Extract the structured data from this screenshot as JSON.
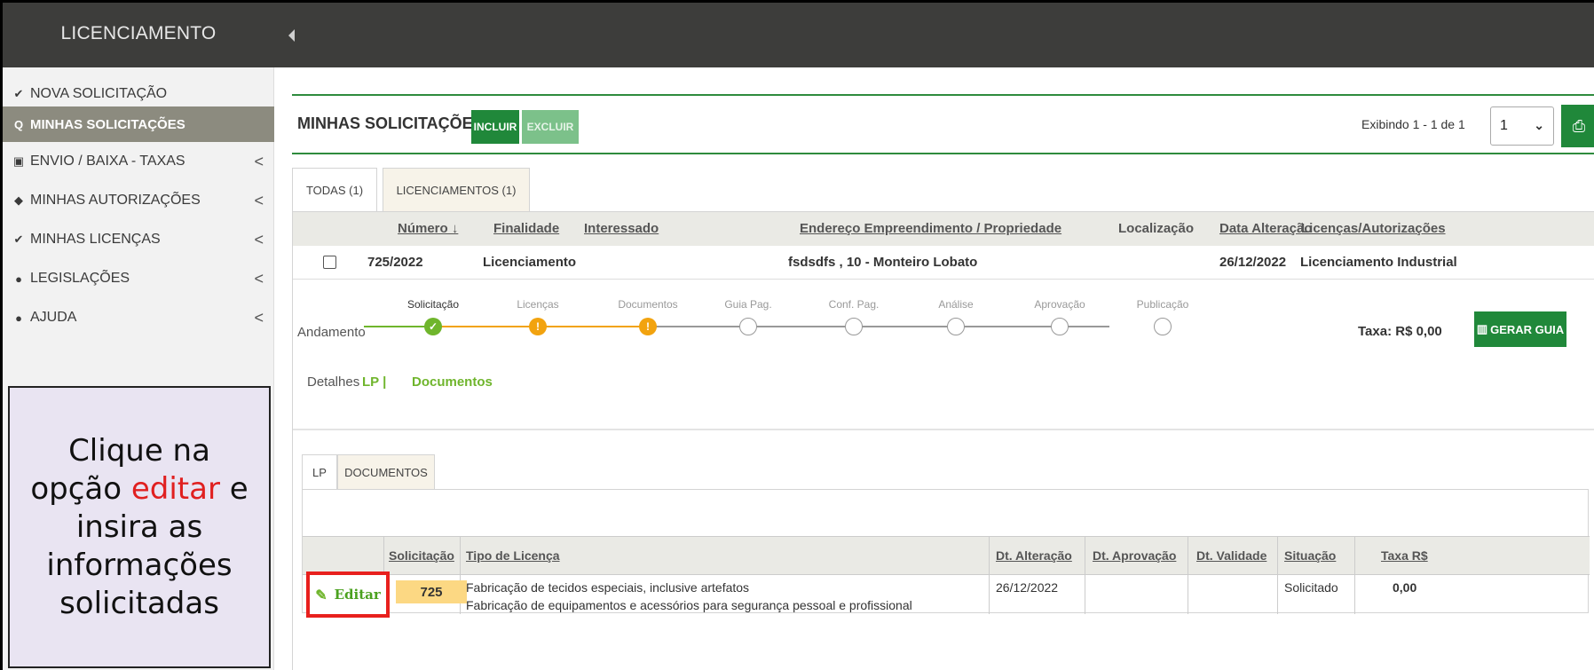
{
  "app": {
    "title": "LICENCIAMENTO"
  },
  "sidebar": {
    "items": [
      {
        "icon": "check-icon",
        "glyph": "✔",
        "label": "NOVA SOLICITAÇÃO"
      },
      {
        "icon": "search-icon",
        "glyph": "Q",
        "label": "MINHAS SOLICITAÇÕES"
      },
      {
        "icon": "money-icon",
        "glyph": "▣",
        "label": "ENVIO / BAIXA - TAXAS"
      },
      {
        "icon": "tag-icon",
        "glyph": "◆",
        "label": "MINHAS AUTORIZAÇÕES"
      },
      {
        "icon": "check-icon",
        "glyph": "✔",
        "label": "MINHAS LICENÇAS"
      },
      {
        "icon": "info-icon",
        "glyph": "●",
        "label": "LEGISLAÇÕES"
      },
      {
        "icon": "info-icon",
        "glyph": "●",
        "label": "AJUDA"
      }
    ],
    "chevron": "<"
  },
  "note": {
    "before": "Clique na opção ",
    "highlight": "editar",
    "after": " e insira as informações solicitadas"
  },
  "header": {
    "title": "MINHAS SOLICITAÇÕES",
    "incluir": "INCLUIR",
    "excluir": "EXCLUIR",
    "exibindo": "Exibindo 1 - 1 de 1",
    "page": "1"
  },
  "tabs": [
    {
      "label": "TODAS (1)"
    },
    {
      "label": "LICENCIAMENTOS (1)"
    }
  ],
  "table": {
    "headers": {
      "numero": "Número ↓",
      "finalidade": "Finalidade",
      "interessado": "Interessado",
      "endereco": "Endereço Empreendimento / Propriedade",
      "localizacao": "Localização",
      "data_alteracao": "Data Alteração",
      "licencas": "Licenças/Autorizações"
    },
    "row": {
      "numero": "725/2022",
      "finalidade": "Licenciamento",
      "interessado": "",
      "endereco": "fsdsdfs , 10 - Monteiro Lobato",
      "localizacao": "",
      "data_alteracao": "26/12/2022",
      "licencas": "Licenciamento Industrial"
    }
  },
  "andamento": {
    "label": "Andamento",
    "steps": [
      {
        "label": "Solicitação",
        "state": "ok"
      },
      {
        "label": "Licenças",
        "state": "warn"
      },
      {
        "label": "Documentos",
        "state": "warn"
      },
      {
        "label": "Guia Pag.",
        "state": "empty"
      },
      {
        "label": "Conf. Pag.",
        "state": "empty"
      },
      {
        "label": "Análise",
        "state": "empty"
      },
      {
        "label": "Aprovação",
        "state": "empty"
      },
      {
        "label": "Publicação",
        "state": "empty"
      }
    ],
    "taxa": "Taxa: R$ 0,00",
    "gerar_guia": "GERAR GUIA"
  },
  "detalhes": {
    "label": "Detalhes",
    "lp": "LP |",
    "documentos": "Documentos"
  },
  "subtabs": [
    {
      "label": "LP"
    },
    {
      "label": "DOCUMENTOS"
    }
  ],
  "subtable": {
    "headers": {
      "solicitacao": "Solicitação",
      "tipo": "Tipo de Licença",
      "dt_alteracao": "Dt. Alteração",
      "dt_aprovacao": "Dt. Aprovação",
      "dt_validade": "Dt. Validade",
      "situacao": "Situação",
      "taxa": "Taxa R$"
    },
    "row": {
      "editar": "Editar",
      "solicitacao": "725",
      "tipo_line1": "Fabricação de tecidos especiais, inclusive artefatos",
      "tipo_line2": "Fabricação de equipamentos e acessórios para segurança pessoal e profissional",
      "dt_alteracao": "26/12/2022",
      "dt_aprovacao": "",
      "dt_validade": "",
      "situacao": "Solicitado",
      "taxa": "0,00"
    }
  },
  "colors": {
    "primary": "#20883a",
    "accent": "#6fb52c",
    "warning": "#f2a30f",
    "highlight": "#e8201d"
  }
}
